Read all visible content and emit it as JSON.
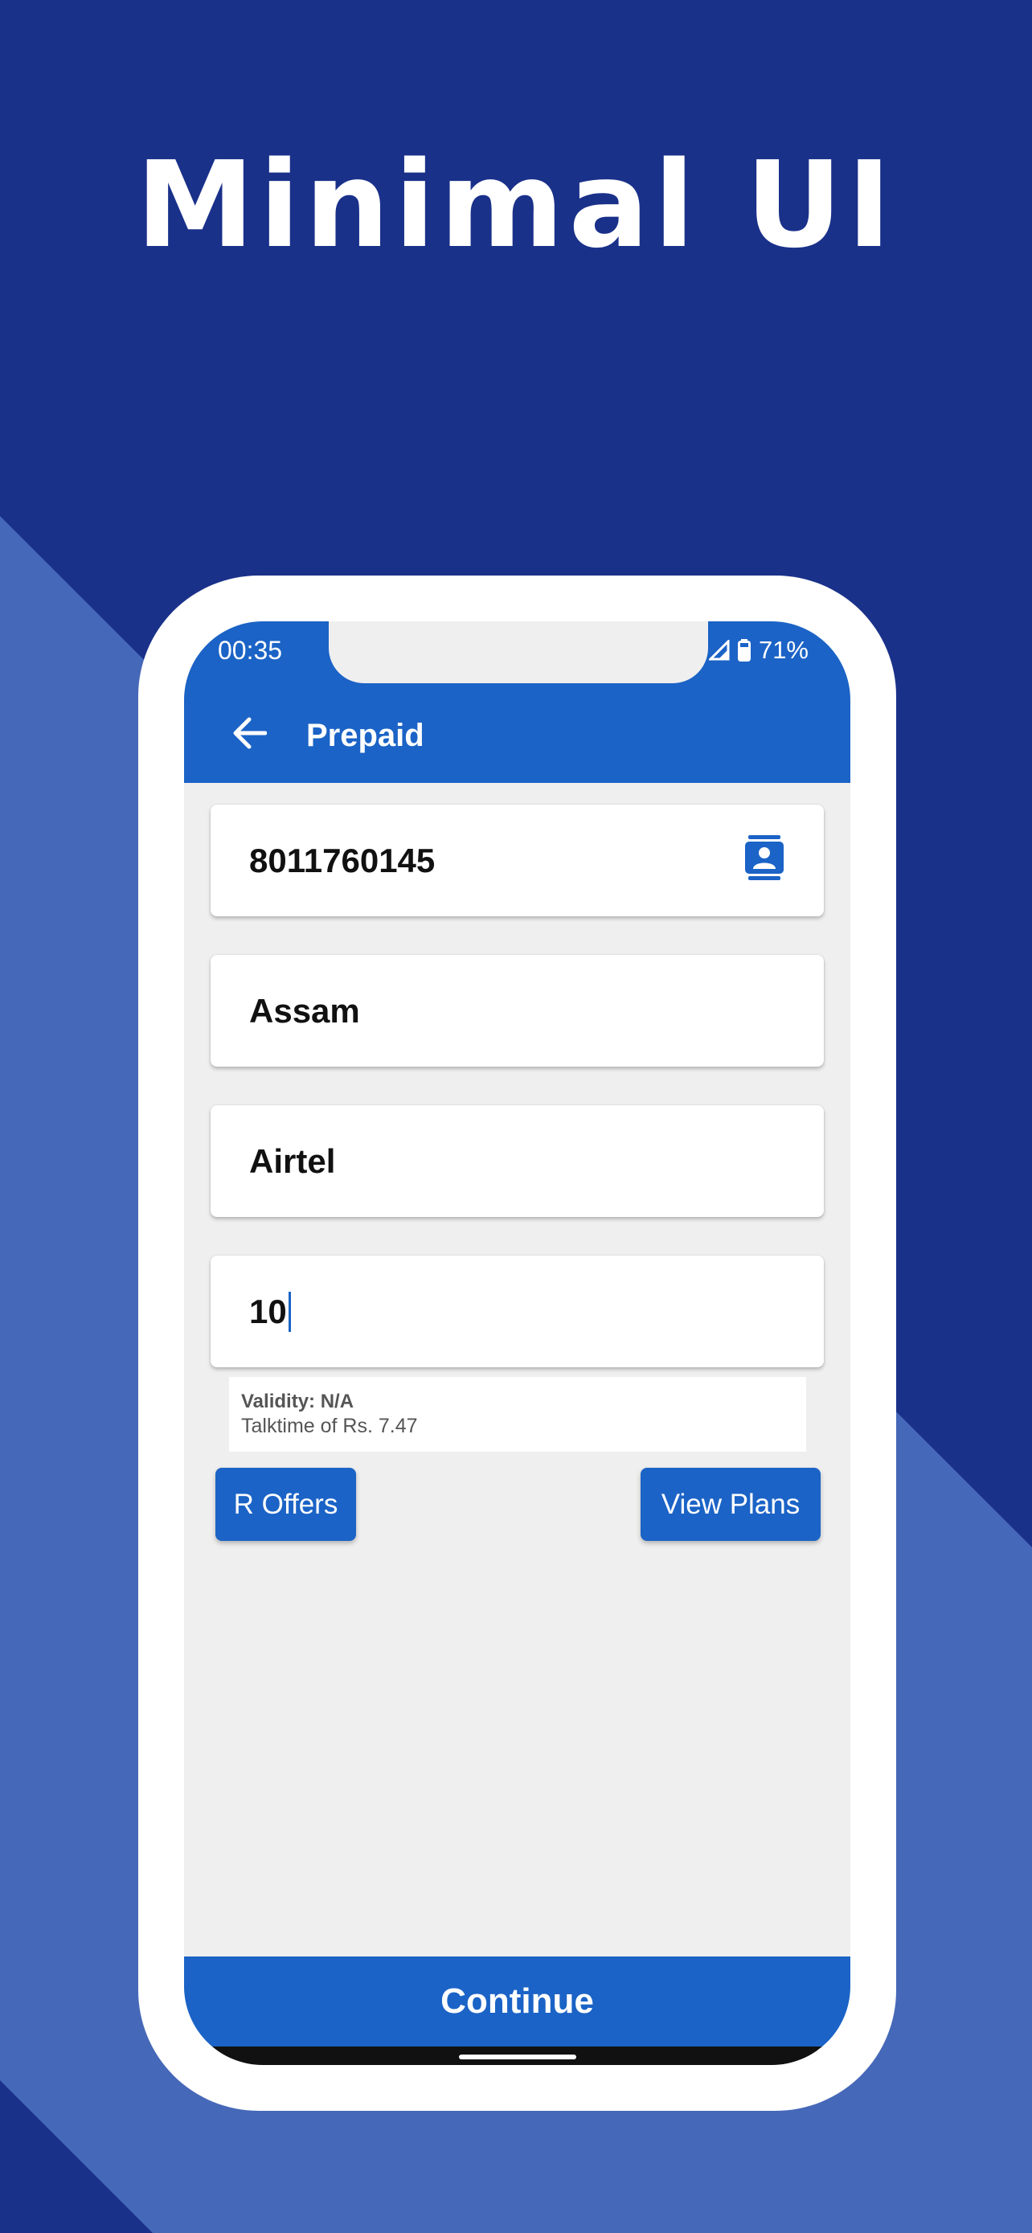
{
  "promo": {
    "title": "Minimal UI",
    "colors": {
      "background_dark": "#1a318a",
      "background_light": "#4668b8"
    }
  },
  "status_bar": {
    "time": "00:35",
    "battery": "71%",
    "icons": [
      "wifi-icon",
      "signal-icon",
      "battery-icon"
    ]
  },
  "app_bar": {
    "title": "Prepaid",
    "back_icon": "arrow-left-icon",
    "color": "#1b63c6"
  },
  "form": {
    "mobile_number": "8011760145",
    "contact_icon": "contact-book-icon",
    "state": "Assam",
    "operator": "Airtel",
    "amount": "10"
  },
  "offer": {
    "validity": "Validity: N/A",
    "talktime": "Talktime of Rs. 7.47"
  },
  "actions": {
    "r_offers": "R Offers",
    "view_plans": "View Plans",
    "continue": "Continue"
  }
}
